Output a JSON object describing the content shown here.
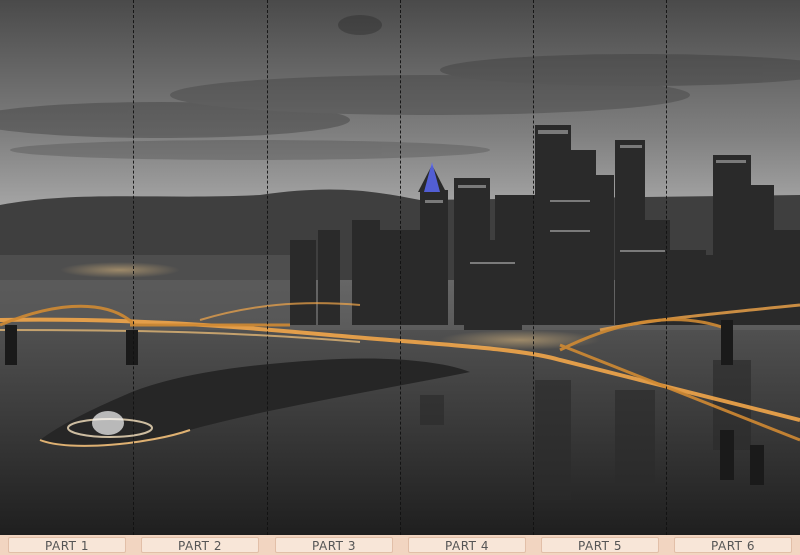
{
  "parts": [
    {
      "label": "PART 1"
    },
    {
      "label": "PART 2"
    },
    {
      "label": "PART 3"
    },
    {
      "label": "PART 4"
    },
    {
      "label": "PART 5"
    },
    {
      "label": "PART 6"
    }
  ],
  "colors": {
    "sky_top": "#3c3c3c",
    "sky_mid": "#9a9a9a",
    "water": "#3a3a3a",
    "city_light": "#f2a64a",
    "label_bg": "#f8e6d8",
    "label_border": "#e2bfa8"
  }
}
